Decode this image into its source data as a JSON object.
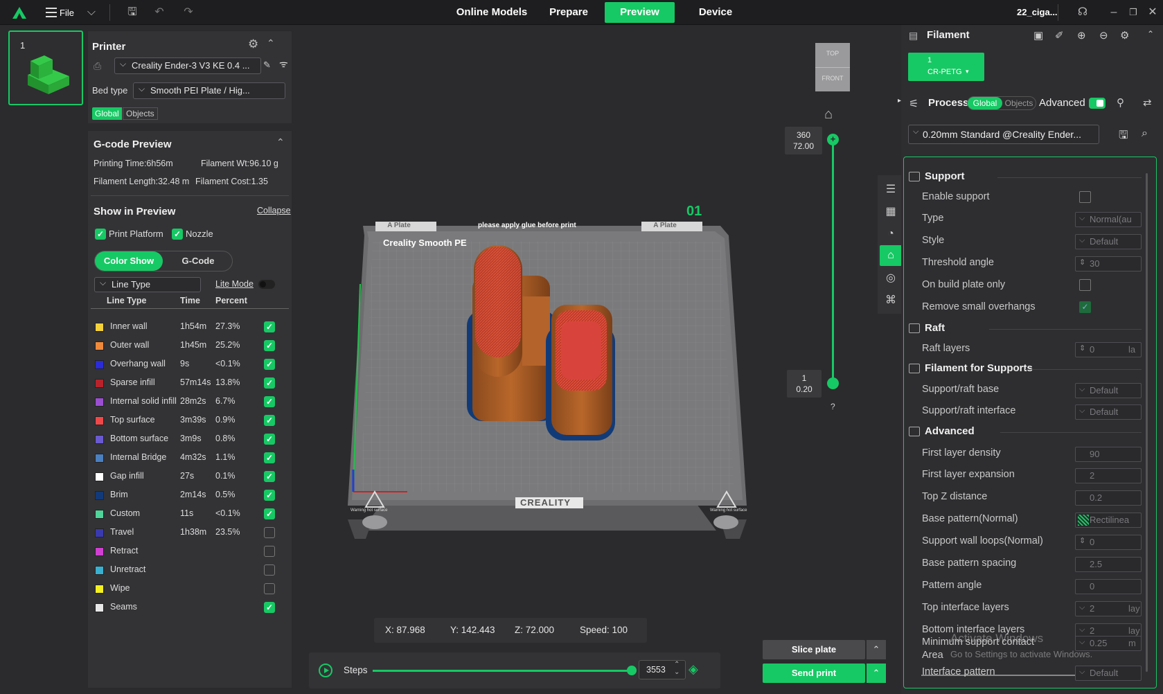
{
  "topbar": {
    "file_label": "File",
    "tabs": [
      "Online Models",
      "Prepare",
      "Preview",
      "Device"
    ],
    "active_tab": "Preview",
    "project_name": "22_ciga...",
    "accent": "#17c964"
  },
  "plate_thumb": {
    "number": "1"
  },
  "printer": {
    "title": "Printer",
    "printer_name": "Creality Ender-3 V3 KE 0.4 ...",
    "bed_type_label": "Bed type",
    "bed_type_value": "Smooth PEI Plate / Hig...",
    "scope_tabs": [
      "Global",
      "Objects"
    ]
  },
  "gcode": {
    "title": "G-code Preview",
    "printing_time": "Printing Time:6h56m",
    "filament_wt": "Filament Wt:96.10 g",
    "filament_length": "Filament Length:32.48 m",
    "filament_cost": "Filament Cost:1.35",
    "show_title": "Show in Preview",
    "collapse": "Collapse",
    "print_platform": "Print Platform",
    "nozzle": "Nozzle",
    "view_tabs": [
      "Color Show",
      "G-Code"
    ],
    "line_type_select": "Line Type",
    "lite_mode": "Lite Mode",
    "headers": [
      "Line Type",
      "Time",
      "Percent"
    ],
    "rows": [
      {
        "name": "Inner wall",
        "time": "1h54m",
        "percent": "27.3%",
        "color": "#f4d13a",
        "checked": true
      },
      {
        "name": "Outer wall",
        "time": "1h45m",
        "percent": "25.2%",
        "color": "#f08a3a",
        "checked": true
      },
      {
        "name": "Overhang wall",
        "time": "9s",
        "percent": "<0.1%",
        "color": "#2b2bd9",
        "checked": true
      },
      {
        "name": "Sparse infill",
        "time": "57m14s",
        "percent": "13.8%",
        "color": "#b8232b",
        "checked": true
      },
      {
        "name": "Internal solid infill",
        "time": "28m2s",
        "percent": "6.7%",
        "color": "#9b4fd0",
        "checked": true
      },
      {
        "name": "Top surface",
        "time": "3m39s",
        "percent": "0.9%",
        "color": "#f04848",
        "checked": true
      },
      {
        "name": "Bottom surface",
        "time": "3m9s",
        "percent": "0.8%",
        "color": "#6a5ad0",
        "checked": true
      },
      {
        "name": "Internal Bridge",
        "time": "4m32s",
        "percent": "1.1%",
        "color": "#4a7fc0",
        "checked": true
      },
      {
        "name": "Gap infill",
        "time": "27s",
        "percent": "0.1%",
        "color": "#ffffff",
        "checked": true
      },
      {
        "name": "Brim",
        "time": "2m14s",
        "percent": "0.5%",
        "color": "#123a78",
        "checked": true
      },
      {
        "name": "Custom",
        "time": "11s",
        "percent": "<0.1%",
        "color": "#4fd49a",
        "checked": true
      },
      {
        "name": "Travel",
        "time": "1h38m",
        "percent": "23.5%",
        "color": "#3a3ab0",
        "checked": false
      },
      {
        "name": "Retract",
        "time": "",
        "percent": "",
        "color": "#d040d0",
        "checked": false
      },
      {
        "name": "Unretract",
        "time": "",
        "percent": "",
        "color": "#3ab0d0",
        "checked": false
      },
      {
        "name": "Wipe",
        "time": "",
        "percent": "",
        "color": "#f4f020",
        "checked": false
      },
      {
        "name": "Seams",
        "time": "",
        "percent": "",
        "color": "#e8e8e8",
        "checked": true
      }
    ]
  },
  "viewport": {
    "plate_number": "01",
    "plate_label_left": "A Plate",
    "plate_label_right": "A Plate",
    "plate_notice": "please apply glue before print",
    "plate_brand": "Creality Smooth PE",
    "plate_logo": "CREALITY",
    "warning_left": "Warning hot surface",
    "warning_right": "Warning hot surface",
    "viewcube_top": "TOP",
    "viewcube_front": "FRONT",
    "layer_top_num": "360",
    "layer_top_h": "72.00",
    "layer_bot_num": "1",
    "layer_bot_h": "0.20",
    "help": "?",
    "coords": {
      "x": "X: 87.968",
      "y": "Y: 142.443",
      "z": "Z: 72.000",
      "speed": "Speed: 100"
    },
    "steps_label": "Steps",
    "steps_value": "3553",
    "slice_label": "Slice plate",
    "send_label": "Send print",
    "watermark_1": "Activate Windows",
    "watermark_2": "Go to Settings to activate Windows."
  },
  "filament": {
    "title": "Filament",
    "slot_num": "1",
    "slot_type": "CR-PETG"
  },
  "process": {
    "title": "Process",
    "scope_tabs": [
      "Global",
      "Objects"
    ],
    "advanced_label": "Advanced",
    "preset": "0.20mm Standard @Creality Ender...",
    "sections": {
      "support": "Support",
      "raft": "Raft",
      "filament_supports": "Filament for Supports",
      "advanced": "Advanced"
    },
    "rows": {
      "enable_support": "Enable support",
      "type": "Type",
      "type_val": "Normal(au",
      "style": "Style",
      "style_val": "Default",
      "threshold": "Threshold angle",
      "threshold_val": "30",
      "build_plate_only": "On build plate only",
      "remove_small": "Remove small overhangs",
      "raft_layers": "Raft layers",
      "raft_layers_val": "0",
      "raft_layers_unit": "la",
      "raft_base": "Support/raft base",
      "raft_base_val": "Default",
      "raft_interface": "Support/raft interface",
      "raft_interface_val": "Default",
      "first_density": "First layer density",
      "first_density_val": "90",
      "first_expansion": "First layer expansion",
      "first_expansion_val": "2",
      "top_z": "Top Z distance",
      "top_z_val": "0.2",
      "base_pattern": "Base pattern(Normal)",
      "base_pattern_val": "Rectilinea",
      "wall_loops": "Support wall loops(Normal)",
      "wall_loops_val": "0",
      "pattern_spacing": "Base pattern spacing",
      "pattern_spacing_val": "2.5",
      "pattern_angle": "Pattern angle",
      "pattern_angle_val": "0",
      "top_iface": "Top interface layers",
      "top_iface_val": "2",
      "top_iface_unit": "lay",
      "bot_iface": "Bottom interface layers",
      "bot_iface_val": "2",
      "bot_iface_unit": "lay",
      "min_contact_1": "Minimum support contact",
      "min_contact_2": "Area",
      "min_contact_val": "0.25",
      "min_contact_unit": "m",
      "iface_pattern": "Interface pattern",
      "iface_pattern_val": "Default"
    }
  }
}
